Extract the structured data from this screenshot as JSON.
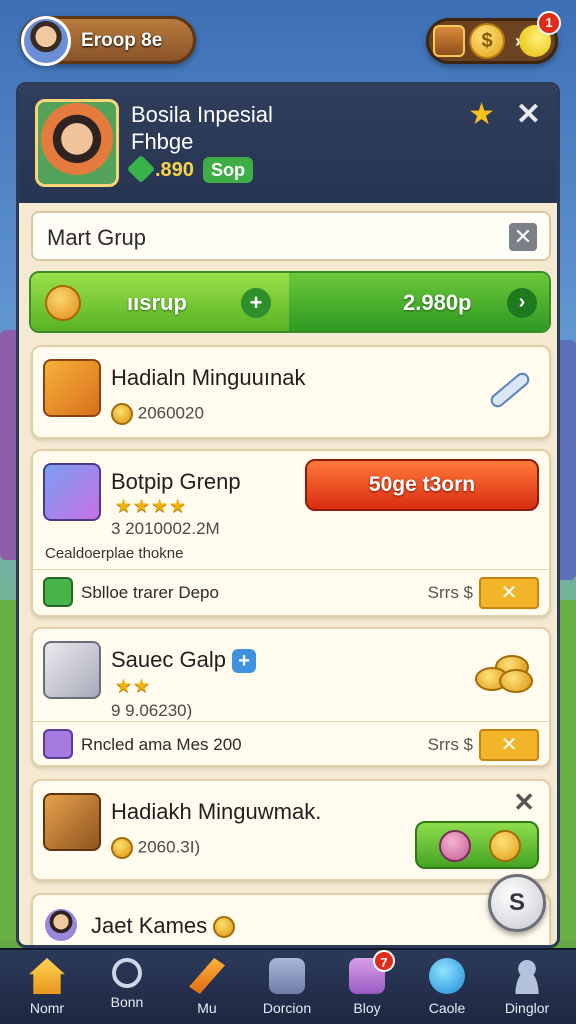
{
  "top_bar": {
    "player_name": "Eroop 8e",
    "wallet_coin_glyph": "$",
    "wallet_separator": "›",
    "notification_count": "1"
  },
  "panel_header": {
    "title_line1": "Bosila Inpesial",
    "title_line2": "Fhbge",
    "amount": ".890",
    "pill": "Sop"
  },
  "search_row": {
    "label": "Mart Grup",
    "close_glyph": "✕"
  },
  "action_bar": {
    "left_label": "ıısrup",
    "plus_glyph": "+",
    "right_label": "2.980p",
    "arrow_glyph": "›"
  },
  "cards": [
    {
      "title": "Hadialn Minguuınak",
      "sub": "2060020"
    },
    {
      "title": "Botpip Grenp",
      "stars": "★★★★",
      "sub": "3 2010002.2M",
      "button": "50ge t3orn",
      "desc": "Cealdoerplae thokne",
      "footer_label": "Sblloe trarer Depo",
      "footer_price": "Srrs $",
      "footer_btn_glyph": "✕"
    },
    {
      "title": "Sauec Galp",
      "plus_glyph": "+",
      "stars": "★★",
      "sub": "9 9.06230)",
      "footer_label": "Rncled ama Mes 200",
      "footer_price": "Srrs $",
      "footer_btn_glyph": "✕"
    },
    {
      "title": "Hadiakh Minguwmak.",
      "sub": "2060.3I)",
      "close_glyph": "✕"
    },
    {
      "title": "Jaet Kames"
    }
  ],
  "fab_label": "S",
  "bottom_nav": {
    "items": [
      {
        "label": "Nomr",
        "icon": "home-icon"
      },
      {
        "label": "Bonn",
        "icon": "search-icon"
      },
      {
        "label": "Mu",
        "icon": "map-icon"
      },
      {
        "label": "Dorcion",
        "icon": "calendar-icon"
      },
      {
        "label": "Bloy",
        "icon": "shop-icon",
        "badge": "7"
      },
      {
        "label": "Caole",
        "icon": "globe-icon"
      },
      {
        "label": "Dinglor",
        "icon": "user-icon"
      }
    ]
  },
  "colors": {
    "panel_bg": "#f4ead2",
    "header_bg": "#2f3e5c",
    "green_button": "#58b224",
    "red_button": "#d92c10",
    "nav_bg": "#1d2741"
  }
}
